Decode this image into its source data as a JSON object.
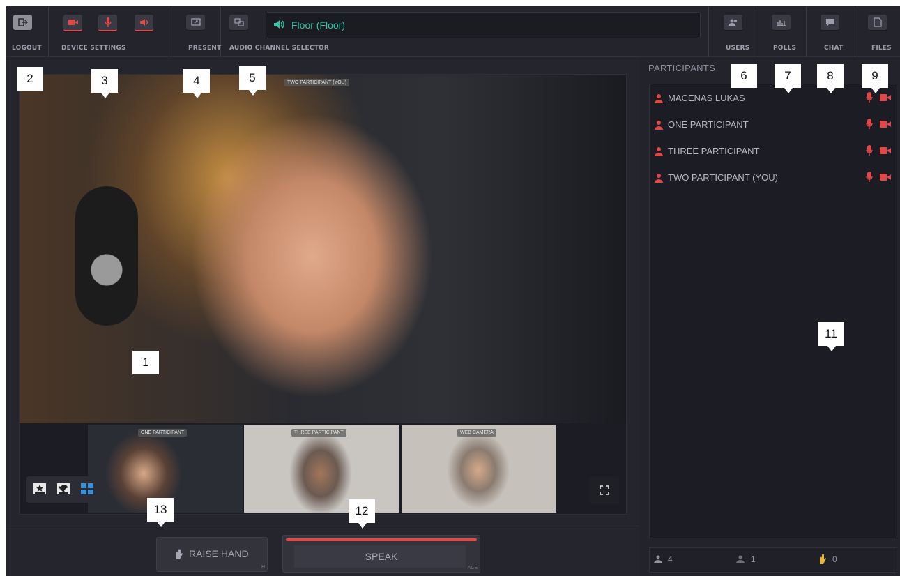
{
  "toolbar": {
    "logout_label": "LOGOUT",
    "device_settings_label": "DEVICE SETTINGS",
    "present_label": "PRESENT",
    "audio_channel_label": "AUDIO CHANNEL SELECTOR",
    "audio_channel_value": "Floor (Floor)",
    "users_label": "USERS",
    "polls_label": "POLLS",
    "chat_label": "CHAT",
    "files_label": "FILES"
  },
  "video": {
    "main_label": "TWO PARTICIPANT (YOU)",
    "thumbnails": [
      {
        "label": "ONE PARTICIPANT"
      },
      {
        "label": "THREE PARTICIPANT"
      },
      {
        "label": "WEB CAMERA"
      }
    ]
  },
  "controls": {
    "raise_hand_label": "RAISE HAND",
    "raise_hand_shortcut": "H",
    "speak_label": "SPEAK",
    "speak_shortcut": "ACE"
  },
  "participants": {
    "title": "PARTICIPANTS",
    "items": [
      {
        "name": "MACENAS LUKAS"
      },
      {
        "name": "ONE PARTICIPANT"
      },
      {
        "name": "THREE PARTICIPANT"
      },
      {
        "name": "TWO PARTICIPANT (YOU)"
      }
    ],
    "stats": {
      "users": "4",
      "speakers": "1",
      "raised_hands": "0"
    }
  },
  "callouts": [
    "1",
    "2",
    "3",
    "4",
    "5",
    "6",
    "7",
    "8",
    "9",
    "11",
    "12",
    "13"
  ],
  "colors": {
    "accent_red": "#e24848",
    "channel_teal": "#2dc7a4",
    "background": "#23232c"
  }
}
